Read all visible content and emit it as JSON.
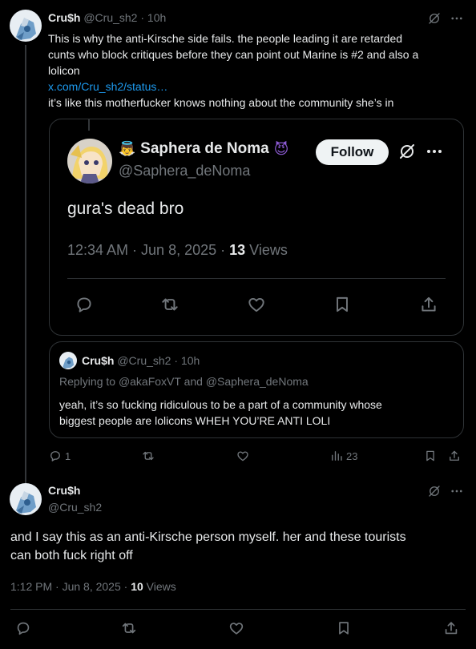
{
  "tweet1": {
    "author_name": "Cru$h",
    "handle": "@Cru_sh2",
    "time": "· 10h",
    "text_line1": "This is why the anti-Kirsche side fails. the people leading it are retarded",
    "text_line2": "cunts who block critiques before they can point out Marine is #2 and also a",
    "text_line3": "lolicon",
    "link_text": "x.com/Cru_sh2/status…",
    "text_line4": "it’s like this motherfucker knows nothing about the community she’s in",
    "reply_count": "1",
    "views_count": "23"
  },
  "embedded": {
    "name": "Saphera de Noma",
    "name_emoji_left": "👼",
    "name_emoji_right": "😈",
    "handle": "@Saphera_deNoma",
    "follow_label": "Follow",
    "text": "gura's dead bro",
    "timestamp": "12:34 AM · Jun 8, 2025 · ",
    "views_num": "13",
    "views_label": " Views"
  },
  "quote": {
    "author_name": "Cru$h",
    "handle": "@Cru_sh2",
    "time": "· 10h",
    "replying_prefix": "Replying to ",
    "replying_to": "@akaFoxVT and @Saphera_deNoma",
    "text_line1": "yeah, it’s so fucking ridiculous to be a part of a community whose",
    "text_line2": "biggest people are lolicons WHEH YOU’RE ANTI LOLI"
  },
  "tweet2": {
    "author_name": "Cru$h",
    "handle": "@Cru_sh2",
    "text_line1": "and I say this as an anti-Kirsche person myself. her and these tourists",
    "text_line2": "can both fuck right off",
    "timestamp": "1:12 PM · Jun 8, 2025 · ",
    "views_num": "10",
    "views_label": " Views"
  },
  "colors": {
    "background": "#000000",
    "text": "#e7e9ea",
    "muted": "#71767b",
    "link": "#1d9bf0",
    "border": "#2f3336",
    "emoji_purple": "#8d5bd4"
  }
}
